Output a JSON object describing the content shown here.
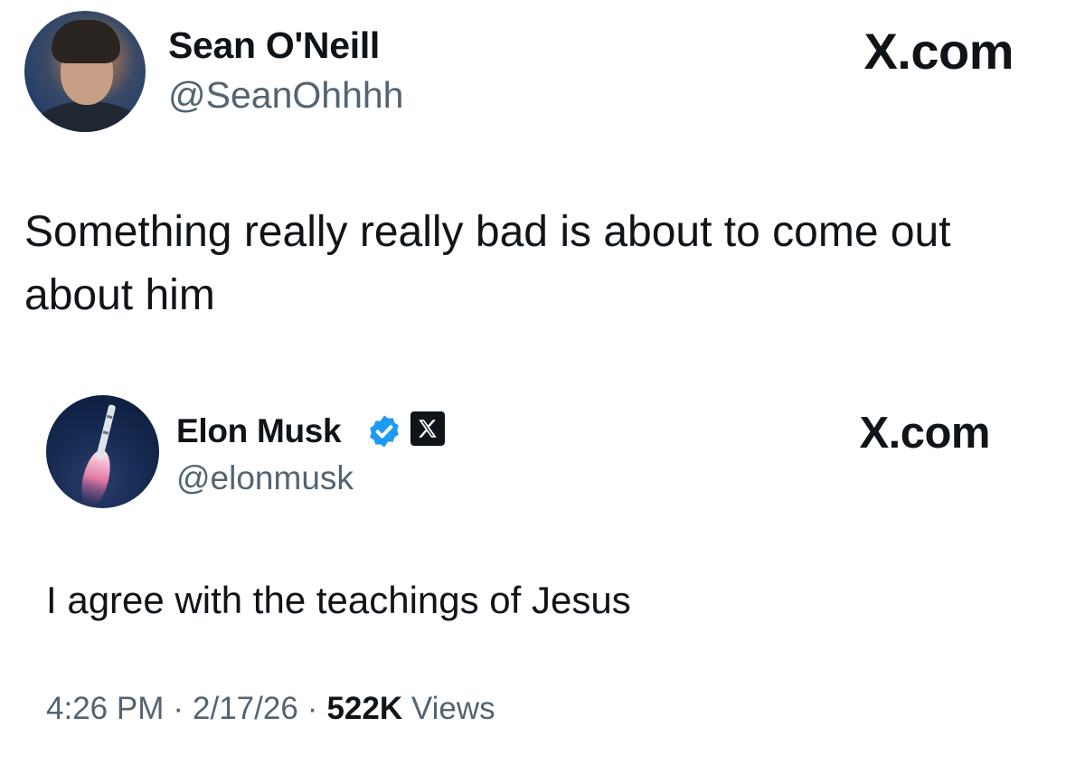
{
  "outer_tweet": {
    "author_name": "Sean O'Neill",
    "author_handle": "@SeanOhhhh",
    "brand": "X.com",
    "text": "Something really really bad is about to come out about him"
  },
  "quoted_tweet": {
    "author_name": "Elon Musk",
    "author_handle": "@elonmusk",
    "brand": "X.com",
    "verified_icon": "verified-checkmark-icon",
    "affiliation_icon": "x-logo-icon",
    "text": "I agree with the teachings of Jesus",
    "time": "4:26 PM",
    "date": "2/17/26",
    "views_count": "522K",
    "views_label": "Views",
    "separator": "·"
  },
  "colors": {
    "text_primary": "#0f1419",
    "text_secondary": "#536471",
    "verified_blue": "#1d9bf0",
    "background": "#ffffff"
  }
}
